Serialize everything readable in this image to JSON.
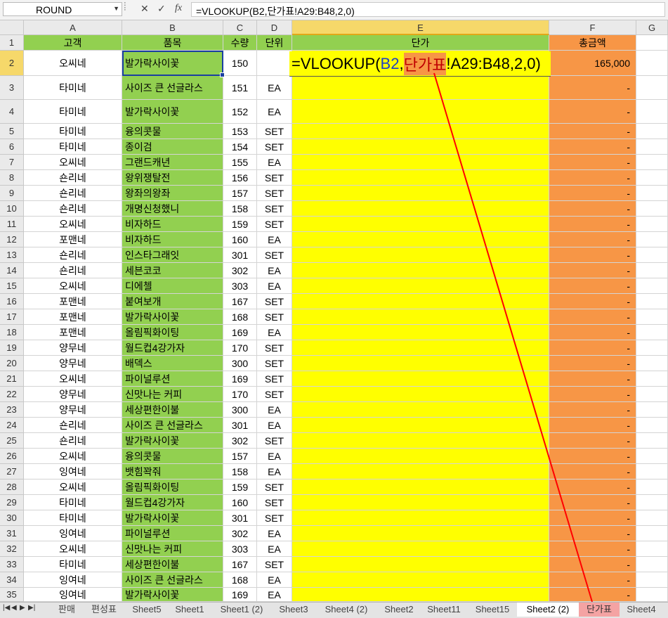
{
  "formula_bar": {
    "name_box": "ROUND",
    "cancel_icon": "✕",
    "enter_icon": "✓",
    "fx_label": "fx",
    "formula_text": "=VLOOKUP(B2,단가표!A29:B48,2,0)"
  },
  "column_letters": [
    "A",
    "B",
    "C",
    "D",
    "E",
    "F",
    "G"
  ],
  "header": {
    "row_number": "1",
    "a": "고객",
    "b": "품목",
    "c": "수량",
    "d": "단위",
    "e": "단가",
    "f": "총금액"
  },
  "edit_cell": {
    "prefix": "=VLOOKUP(",
    "ref1": "B2",
    "comma": ",",
    "sheet_ref": "단가표",
    "rest": "!A29:B48,2,0)"
  },
  "rows": [
    {
      "n": "2",
      "a": "오씨네",
      "b": "발가락사이꽃",
      "c": "150",
      "d": "",
      "f": "165,000"
    },
    {
      "n": "3",
      "a": "타미네",
      "b": "사이즈 큰 선글라스",
      "c": "151",
      "d": "EA",
      "f": "-"
    },
    {
      "n": "4",
      "a": "타미네",
      "b": "발가락사이꽃",
      "c": "152",
      "d": "EA",
      "f": "-"
    },
    {
      "n": "5",
      "a": "타미네",
      "b": "융의콧물",
      "c": "153",
      "d": "SET",
      "f": "-"
    },
    {
      "n": "6",
      "a": "타미네",
      "b": "종이검",
      "c": "154",
      "d": "SET",
      "f": "-"
    },
    {
      "n": "7",
      "a": "오씨네",
      "b": "그랜드캐년",
      "c": "155",
      "d": "EA",
      "f": "-"
    },
    {
      "n": "8",
      "a": "숀리네",
      "b": "왕위쟁탈전",
      "c": "156",
      "d": "SET",
      "f": "-"
    },
    {
      "n": "9",
      "a": "숀리네",
      "b": "왕좌의왕좌",
      "c": "157",
      "d": "SET",
      "f": "-"
    },
    {
      "n": "10",
      "a": "숀리네",
      "b": "개명신청했니",
      "c": "158",
      "d": "SET",
      "f": "-"
    },
    {
      "n": "11",
      "a": "오씨네",
      "b": "비자하드",
      "c": "159",
      "d": "SET",
      "f": "-"
    },
    {
      "n": "12",
      "a": "포맨네",
      "b": "비자하드",
      "c": "160",
      "d": "EA",
      "f": "-"
    },
    {
      "n": "13",
      "a": "숀리네",
      "b": "인스타그래잇",
      "c": "301",
      "d": "SET",
      "f": "-"
    },
    {
      "n": "14",
      "a": "숀리네",
      "b": "세븐코코",
      "c": "302",
      "d": "EA",
      "f": "-"
    },
    {
      "n": "15",
      "a": "오씨네",
      "b": "디에첼",
      "c": "303",
      "d": "EA",
      "f": "-"
    },
    {
      "n": "16",
      "a": "포맨네",
      "b": "붙여보개",
      "c": "167",
      "d": "SET",
      "f": "-"
    },
    {
      "n": "17",
      "a": "포맨네",
      "b": "발가락사이꽃",
      "c": "168",
      "d": "SET",
      "f": "-"
    },
    {
      "n": "18",
      "a": "포맨네",
      "b": "올림픽화이팅",
      "c": "169",
      "d": "EA",
      "f": "-"
    },
    {
      "n": "19",
      "a": "양무네",
      "b": "월드컵4강가자",
      "c": "170",
      "d": "SET",
      "f": "-"
    },
    {
      "n": "20",
      "a": "양무네",
      "b": "배덱스",
      "c": "300",
      "d": "SET",
      "f": "-"
    },
    {
      "n": "21",
      "a": "오씨네",
      "b": "파이널루션",
      "c": "169",
      "d": "SET",
      "f": "-"
    },
    {
      "n": "22",
      "a": "양무네",
      "b": "신맛나는 커피",
      "c": "170",
      "d": "SET",
      "f": "-"
    },
    {
      "n": "23",
      "a": "양무네",
      "b": "세상편한이불",
      "c": "300",
      "d": "EA",
      "f": "-"
    },
    {
      "n": "24",
      "a": "숀리네",
      "b": "사이즈 큰 선글라스",
      "c": "301",
      "d": "EA",
      "f": "-"
    },
    {
      "n": "25",
      "a": "숀리네",
      "b": "발가락사이꽃",
      "c": "302",
      "d": "SET",
      "f": "-"
    },
    {
      "n": "26",
      "a": "오씨네",
      "b": "융의콧물",
      "c": "157",
      "d": "EA",
      "f": "-"
    },
    {
      "n": "27",
      "a": "잉여네",
      "b": "뱃힘꽉줘",
      "c": "158",
      "d": "EA",
      "f": "-"
    },
    {
      "n": "28",
      "a": "오씨네",
      "b": "올림픽화이팅",
      "c": "159",
      "d": "SET",
      "f": "-"
    },
    {
      "n": "29",
      "a": "타미네",
      "b": "월드컵4강가자",
      "c": "160",
      "d": "SET",
      "f": "-"
    },
    {
      "n": "30",
      "a": "타미네",
      "b": "발가락사이꽃",
      "c": "301",
      "d": "SET",
      "f": "-"
    },
    {
      "n": "31",
      "a": "잉여네",
      "b": "파이널루션",
      "c": "302",
      "d": "EA",
      "f": "-"
    },
    {
      "n": "32",
      "a": "오씨네",
      "b": "신맛나는 커피",
      "c": "303",
      "d": "EA",
      "f": "-"
    },
    {
      "n": "33",
      "a": "타미네",
      "b": "세상편한이불",
      "c": "167",
      "d": "SET",
      "f": "-"
    },
    {
      "n": "34",
      "a": "잉여네",
      "b": "사이즈 큰 선글라스",
      "c": "168",
      "d": "EA",
      "f": "-"
    },
    {
      "n": "35",
      "a": "잉여네",
      "b": "발가락사이꽃",
      "c": "169",
      "d": "EA",
      "f": "-"
    }
  ],
  "sheet_nav_icons": [
    "|◀",
    "◀",
    "▶",
    "▶|"
  ],
  "sheet_tabs": [
    "판매",
    "편성표",
    "Sheet5",
    "Sheet1",
    "Sheet1 (2)",
    "Sheet3",
    "Sheet4 (2)",
    "Sheet2",
    "Sheet11",
    "Sheet15",
    "Sheet2 (2)",
    "단가표",
    "Sheet4"
  ],
  "active_tab": "Sheet2 (2)",
  "highlighted_tab": "단가표",
  "colors": {
    "green": "#92d050",
    "yellow": "#ffff00",
    "orange": "#f79646",
    "arrow": "#ff0000"
  }
}
